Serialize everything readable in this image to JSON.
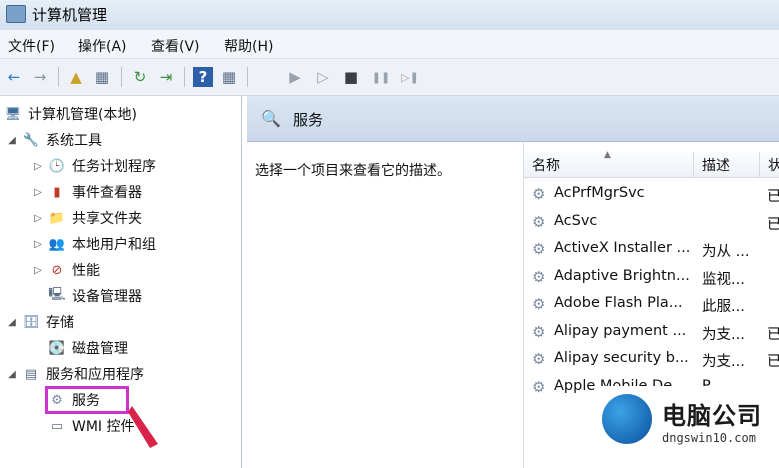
{
  "window": {
    "title": "计算机管理"
  },
  "menu": [
    "文件(F)",
    "操作(A)",
    "查看(V)",
    "帮助(H)"
  ],
  "toolbar": {
    "back": "←",
    "forward": "→",
    "up": "▲",
    "show_tree": "▦",
    "refresh": "↻",
    "export": "⇥",
    "help": "?",
    "properties": "▦",
    "play": "▶",
    "play2": "▷",
    "stop": "■",
    "pause": "❚❚",
    "restart": "▷❚"
  },
  "tree": {
    "root": "计算机管理(本地)",
    "system_tools": "系统工具",
    "task_scheduler": "任务计划程序",
    "event_viewer": "事件查看器",
    "shared_folders": "共享文件夹",
    "local_users": "本地用户和组",
    "performance": "性能",
    "device_manager": "设备管理器",
    "storage": "存储",
    "disk_management": "磁盘管理",
    "services_apps": "服务和应用程序",
    "services": "服务",
    "wmi": "WMI 控件"
  },
  "main": {
    "header": "服务",
    "description": "选择一个项目来查看它的描述。",
    "columns": {
      "name": "名称",
      "desc": "描述",
      "state": "状"
    },
    "services": [
      {
        "name": "AcPrfMgrSvc",
        "desc": "",
        "state": "已"
      },
      {
        "name": "AcSvc",
        "desc": "",
        "state": "已"
      },
      {
        "name": "ActiveX Installer ...",
        "desc": "为从 ...",
        "state": ""
      },
      {
        "name": "Adaptive Brightn...",
        "desc": "监视...",
        "state": ""
      },
      {
        "name": "Adobe Flash Pla...",
        "desc": "此服...",
        "state": ""
      },
      {
        "name": "Alipay payment ...",
        "desc": "为支...",
        "state": "已"
      },
      {
        "name": "Alipay security b...",
        "desc": "为支...",
        "state": "已"
      },
      {
        "name": "Apple Mobile De...",
        "desc": "P...",
        "state": ""
      }
    ]
  },
  "watermark": {
    "text": "电脑公司",
    "url": "dngswin10.com"
  }
}
